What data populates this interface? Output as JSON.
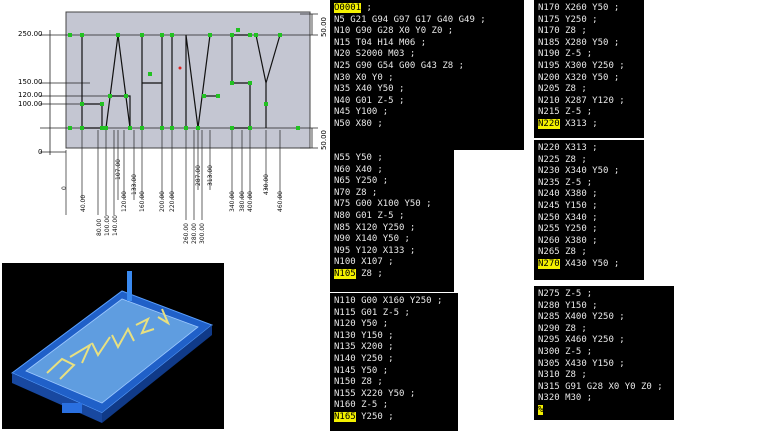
{
  "drawing": {
    "y_labels": [
      "250.00",
      "150.00",
      "120.00",
      "100.00",
      "0"
    ],
    "right_labels": [
      "50.00",
      "50.00"
    ],
    "x_labels": [
      "0",
      "40.00",
      "80.00",
      "100.00",
      "140.00",
      "107.00",
      "120.00",
      "133.00",
      "160.00",
      "200.00",
      "220.00",
      "260.00",
      "280.00",
      "300.00",
      "287.00",
      "313.00",
      "340.00",
      "380.00",
      "400.00",
      "430.00",
      "460.00"
    ]
  },
  "model": {
    "description_icon": "cnc-part-3d-model-icon"
  },
  "panels": [
    {
      "lines": [
        "O0001 ;",
        "N5 G21 G94 G97 G17 G40 G49 ;",
        "N10 G90 G28 X0 Y0 Z0 ;",
        "N15 T04 H14 M06 ;",
        "N20 S2000 M03 ;",
        "N25 G90 G54 G00 G43 Z8 ;",
        "N30 X0 Y0 ;",
        "N35 X40 Y50 ;",
        "N40 G01 Z-5 ;",
        "N45 Y100 ;",
        "N50 X80 ;"
      ]
    },
    {
      "lines": [
        "N170 X260 Y50 ;",
        "N175 Y250 ;",
        "N170 Z8 ;",
        "N185 X280 Y50 ;",
        "N190 Z-5 ;",
        "N195 X300 Y250 ;",
        "N200 X320 Y50 ;",
        "N205 Z8 ;",
        "N210 X287 Y120 ;",
        "N215 Z-5 ;",
        "N220 X313 ;"
      ]
    },
    {
      "lines": [
        "N55 Y50 ;",
        "N60 X40 ;",
        "N65 Y250 ;",
        "N70 Z8 ;",
        "N75 G00 X100 Y50 ;",
        "N80 G01 Z-5 ;",
        "N85 X120 Y250 ;",
        "N90 X140 Y50 ;",
        "N95 Y120 X133 ;",
        "N100 X107 ;",
        "N105 Z8 ;"
      ]
    },
    {
      "lines": [
        "N220 X313 ;",
        "N225 Z8 ;",
        "N230 X340 Y50 ;",
        "N235 Z-5 ;",
        "N240 X380 ;",
        "N245 Y150 ;",
        "N250 X340 ;",
        "N255 Y250 ;",
        "N260 X380 ;",
        "N265 Z8 ;",
        "N270 X430 Y50 ;"
      ]
    },
    {
      "lines": [
        "N110 G00 X160 Y250 ;",
        "N115 G01 Z-5 ;",
        "N120 Y50 ;",
        "N130 Y150 ;",
        "N135 X200 ;",
        "N140 Y250 ;",
        "N145 Y50 ;",
        "N150 Z8 ;",
        "N155 X220 Y50 ;",
        "N160 Z-5 ;",
        "N165 Y250 ;"
      ]
    },
    {
      "lines": [
        "N275 Z-5 ;",
        "N280 Y150 ;",
        "N285 X400 Y250 ;",
        "N290 Z8 ;",
        "N295 X460 Y250 ;",
        "N300 Z-5 ;",
        "N305 X430 Y150 ;",
        "N310 Z8 ;",
        "N315 G91 G28 X0 Y0 Z0 ;",
        "N320 M30 ;",
        "%"
      ]
    }
  ]
}
